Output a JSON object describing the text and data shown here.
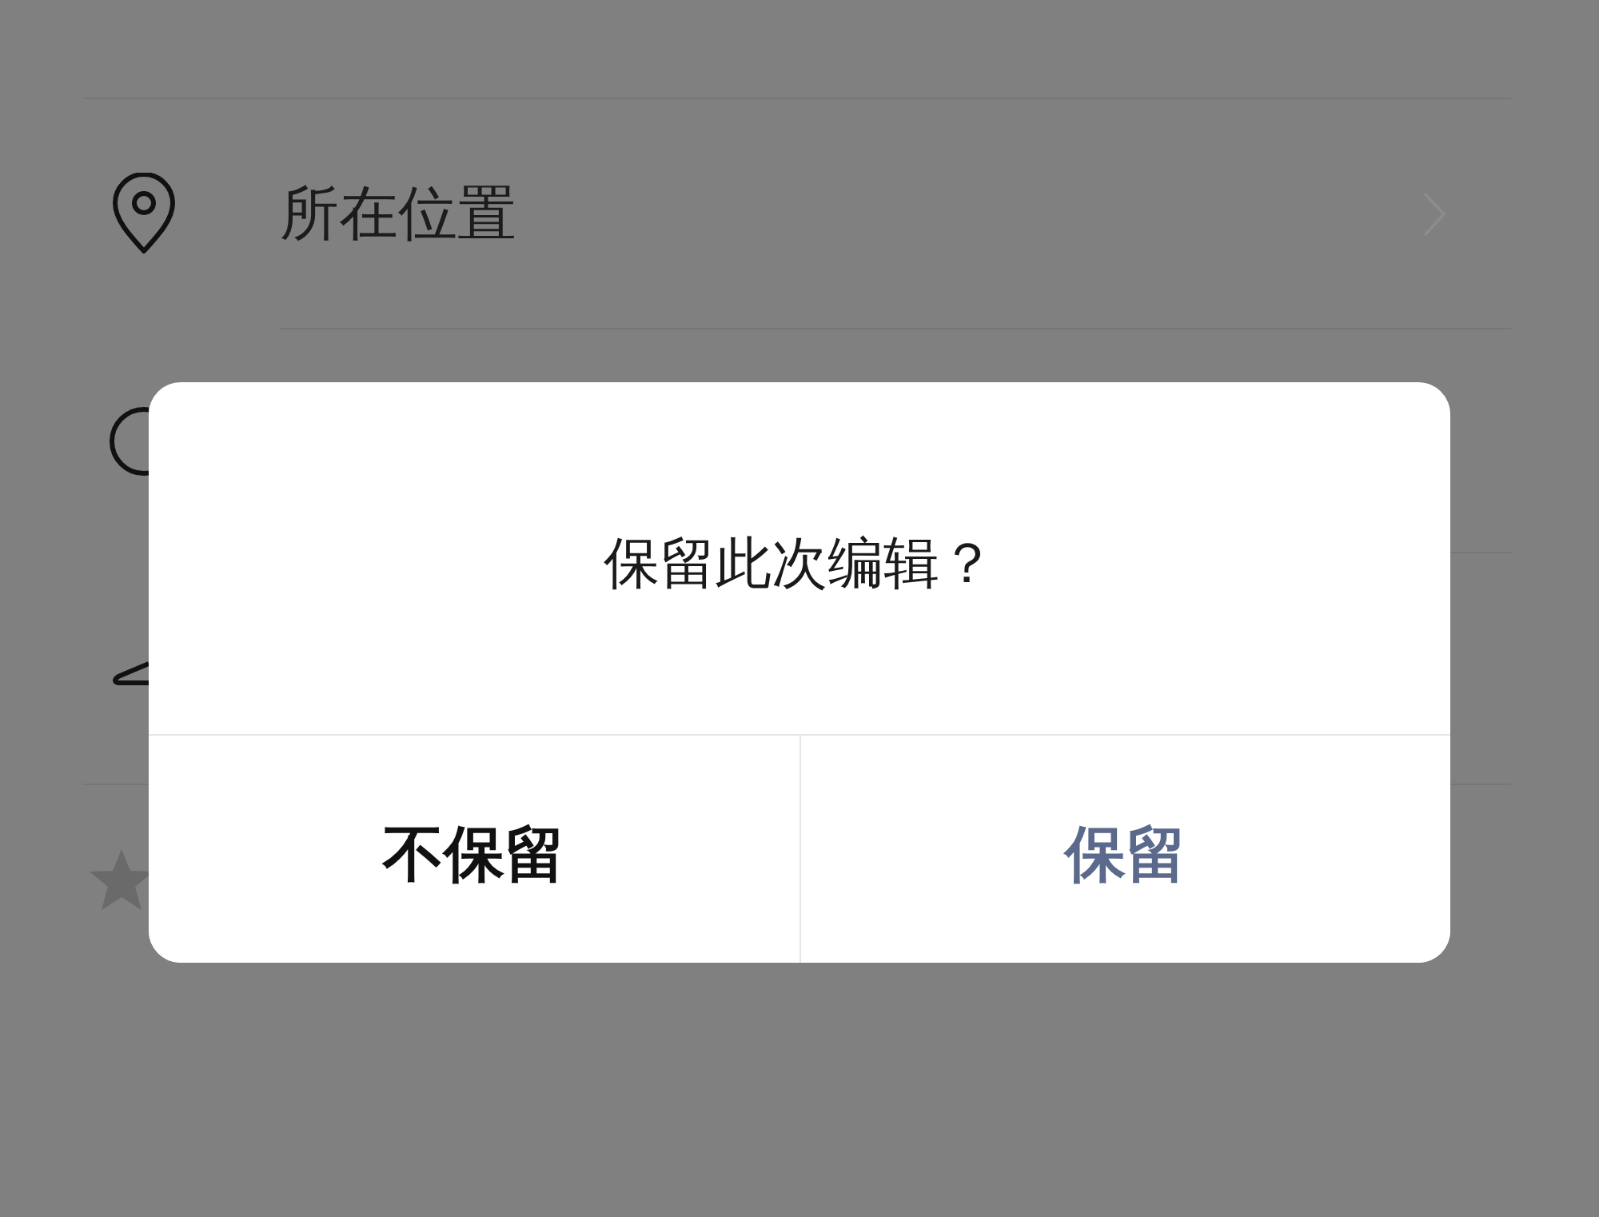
{
  "list": {
    "items": [
      {
        "kind": "location",
        "label": "所在位置",
        "chevron": true
      },
      {
        "kind": "circle"
      },
      {
        "kind": "hanger"
      },
      {
        "kind": "star"
      }
    ]
  },
  "dialog": {
    "title": "保留此次编辑？",
    "buttons": [
      {
        "kind": "secondary",
        "label": "不保留"
      },
      {
        "kind": "primary",
        "label": "保留"
      }
    ]
  }
}
